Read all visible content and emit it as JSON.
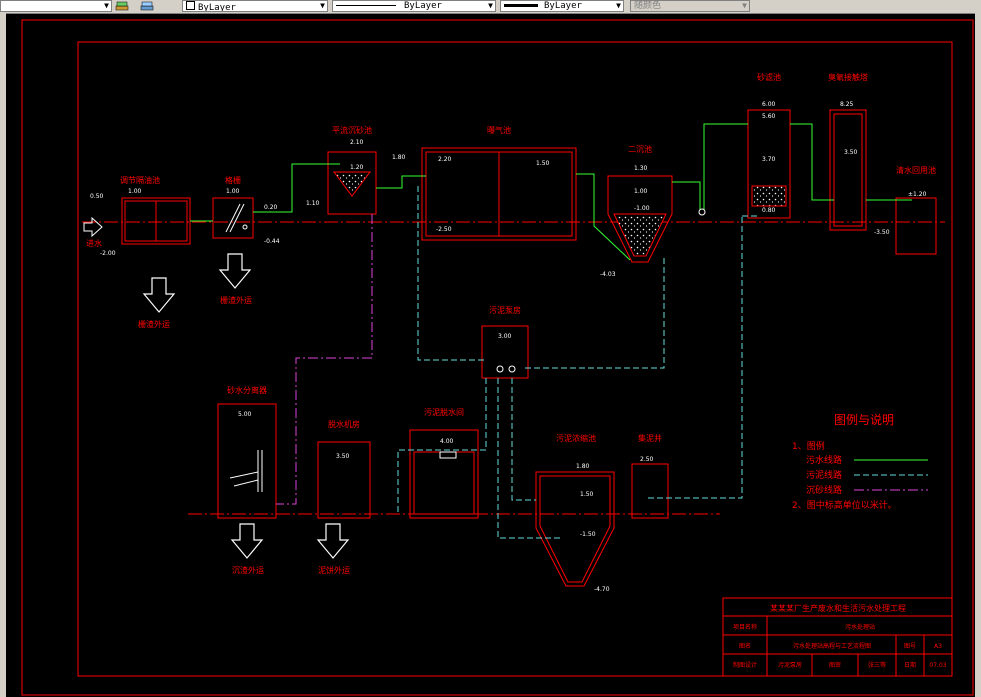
{
  "toolbar": {
    "layer_combo": "ByLayer",
    "linetype_combo": "ByLayer",
    "lineweight_combo": "ByLayer",
    "plotstyle_combo": "随颜色"
  },
  "colors": {
    "background": "#000000",
    "frame": "#ff0000",
    "label": "#ff0000",
    "dimension": "#ffffff",
    "sewage_line": "#33ff33",
    "sludge_line": "#66dddd",
    "grit_line": "#dd44dd"
  },
  "units": {
    "grille_tank": {
      "name": "调节隔油池",
      "top": "1.00",
      "bottom": "-2.00",
      "inlet_level": "0.50"
    },
    "screen": {
      "name": "格栅",
      "top": "1.00",
      "out": "0.20",
      "bottom": "-0.44"
    },
    "grit_chamber": {
      "name": "平流沉砂池",
      "top": "2.10",
      "water": "1.80",
      "mid": "1.20",
      "bottom": "1.10"
    },
    "aeration_tank": {
      "name": "曝气池",
      "top": "2.20",
      "water": "1.50",
      "bottom": "-2.50"
    },
    "clarifier": {
      "name": "二沉池",
      "top": "1.30",
      "water": "1.00",
      "mid": "-1.00",
      "bottom": "-4.03"
    },
    "sand_filter": {
      "name": "砂滤池",
      "top": "6.00",
      "water": "5.60",
      "mid": "3.70",
      "bottom": "0.80"
    },
    "ozone_tank": {
      "name": "臭氧接触塔",
      "top": "8.25",
      "water": "3.50"
    },
    "clear_water_tank": {
      "name": "清水回用池",
      "top": "±1.20",
      "bottom": "-3.50"
    },
    "sludge_pump_house": {
      "name": "污泥泵房",
      "level": "3.00"
    },
    "water_distribution_well": {
      "name": "砂水分离器",
      "level": "5.00"
    },
    "dewatering_room": {
      "name": "脱水机房",
      "level": "3.50"
    },
    "sludge_dewatering": {
      "name": "污泥脱水间",
      "level": "4.00"
    },
    "sludge_thickener": {
      "name": "污泥浓缩池",
      "top": "1.80",
      "water": "1.50",
      "mid": "-1.50",
      "bottom": "-4.70"
    },
    "filtrate_well": {
      "name": "集泥井",
      "level": "2.50"
    }
  },
  "inlet_label": "进水",
  "arrows": {
    "arrow1": "栅渣外运",
    "arrow2": "栅渣外运",
    "arrow3": "沉渣外运",
    "arrow4": "泥饼外运"
  },
  "legend": {
    "title": "图例与说明",
    "item1_header": "1、图例",
    "sewage": "污水线路",
    "sludge": "污泥线路",
    "grit": "沉砂线路",
    "note": "2、图中标高单位以米计。"
  },
  "title_block": {
    "project": "某某某厂生产废水和生活污水处理工程",
    "row2_label": "项目名称",
    "row2_value": "污水处理站",
    "row3_label": "图名",
    "row3_value": "污水处理站高程与工艺流程图",
    "page_label": "图号",
    "page_value": "A3",
    "row4_c1": "制图设计",
    "row4_c2": "污泥泵房",
    "row4_c3": "图审",
    "row4_c4": "张三等",
    "date_label": "日期",
    "date_value": "07.03"
  }
}
